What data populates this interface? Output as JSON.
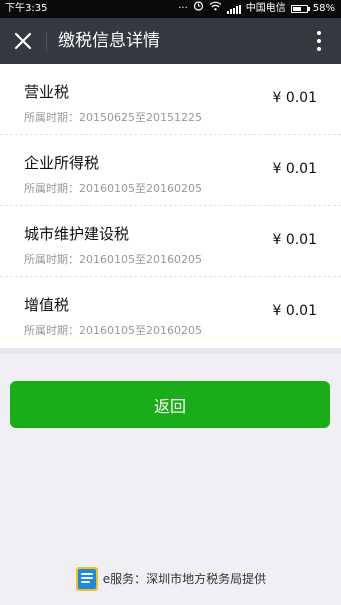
{
  "status_bar": {
    "time": "下午3:35",
    "dots": "···",
    "carrier": "中国电信",
    "battery": "58%",
    "battery_level": 0.58
  },
  "header": {
    "title": "缴税信息详情"
  },
  "tax_items": [
    {
      "name": "营业税",
      "period": "所属时期：20150625至20151225",
      "amount": "¥ 0.01"
    },
    {
      "name": "企业所得税",
      "period": "所属时期：20160105至20160205",
      "amount": "¥ 0.01"
    },
    {
      "name": "城市维护建设税",
      "period": "所属时期：20160105至20160205",
      "amount": "¥ 0.01"
    },
    {
      "name": "增值税",
      "period": "所属时期：20160105至20160205",
      "amount": "¥ 0.01"
    }
  ],
  "back_button": {
    "label": "返回"
  },
  "footer": {
    "text": "e服务：深圳市地方税务局提供",
    "logo_icon": "tax-service-logo-icon"
  },
  "colors": {
    "nav_bg": "#34393f",
    "button_green": "#1aad19",
    "page_bg": "#f0eff4"
  }
}
